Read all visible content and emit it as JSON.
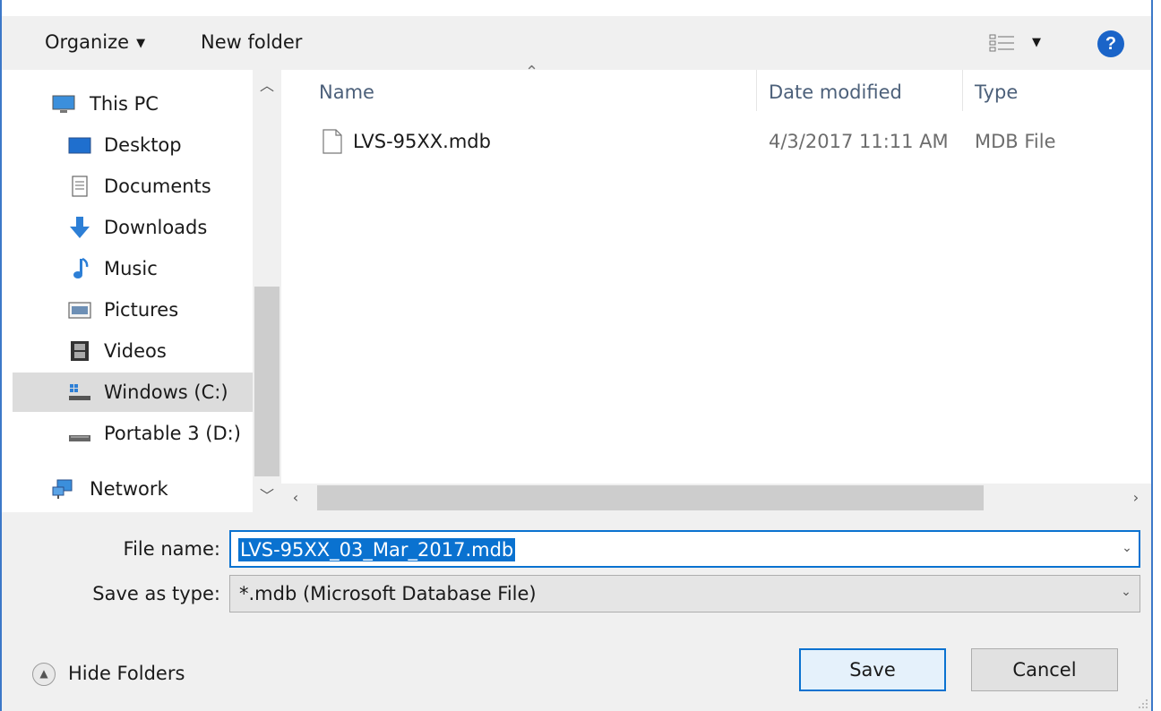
{
  "toolbar": {
    "organize_label": "Organize",
    "new_folder_label": "New folder",
    "help_glyph": "?"
  },
  "nav": {
    "items": [
      {
        "label": "This PC",
        "icon": "monitor-icon"
      },
      {
        "label": "Desktop",
        "icon": "desktop-icon"
      },
      {
        "label": "Documents",
        "icon": "documents-icon"
      },
      {
        "label": "Downloads",
        "icon": "download-arrow-icon"
      },
      {
        "label": "Music",
        "icon": "music-note-icon"
      },
      {
        "label": "Pictures",
        "icon": "pictures-icon"
      },
      {
        "label": "Videos",
        "icon": "film-icon"
      },
      {
        "label": "Windows (C:)",
        "icon": "windows-drive-icon"
      },
      {
        "label": "Portable 3 (D:)",
        "icon": "drive-icon"
      },
      {
        "label": "Network",
        "icon": "network-icon"
      }
    ],
    "selected": "Windows (C:)"
  },
  "file_list": {
    "columns": [
      "Name",
      "Date modified",
      "Type"
    ],
    "rows": [
      {
        "name": "LVS-95XX.mdb",
        "date": "4/3/2017 11:11 AM",
        "type": "MDB File"
      }
    ]
  },
  "form": {
    "file_name_label": "File name:",
    "file_name_value": "LVS-95XX_03_Mar_2017.mdb",
    "save_as_type_label": "Save as type:",
    "save_as_type_value": "*.mdb (Microsoft Database File)",
    "hide_folders_label": "Hide Folders",
    "save_label": "Save",
    "cancel_label": "Cancel"
  },
  "colors": {
    "accent": "#0a72d0",
    "selection": "#dcdcdc",
    "panel": "#f0f0f0"
  }
}
